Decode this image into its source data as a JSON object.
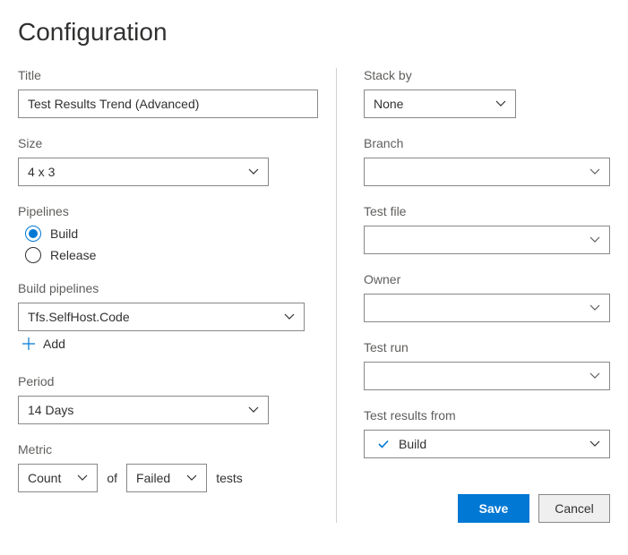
{
  "heading": "Configuration",
  "left": {
    "title_label": "Title",
    "title_value": "Test Results Trend (Advanced)",
    "size_label": "Size",
    "size_value": "4 x 3",
    "pipelines_label": "Pipelines",
    "pipelines_options": {
      "build": "Build",
      "release": "Release"
    },
    "build_pipelines_label": "Build pipelines",
    "build_pipelines_value": "Tfs.SelfHost.Code",
    "add_label": "Add",
    "period_label": "Period",
    "period_value": "14 Days",
    "metric_label": "Metric",
    "metric_left": "Count",
    "metric_of": "of",
    "metric_right": "Failed",
    "metric_suffix": "tests"
  },
  "right": {
    "stack_by_label": "Stack by",
    "stack_by_value": "None",
    "branch_label": "Branch",
    "branch_value": "",
    "test_file_label": "Test file",
    "test_file_value": "",
    "owner_label": "Owner",
    "owner_value": "",
    "test_run_label": "Test run",
    "test_run_value": "",
    "results_from_label": "Test results from",
    "results_from_value": "Build",
    "save": "Save",
    "cancel": "Cancel"
  }
}
